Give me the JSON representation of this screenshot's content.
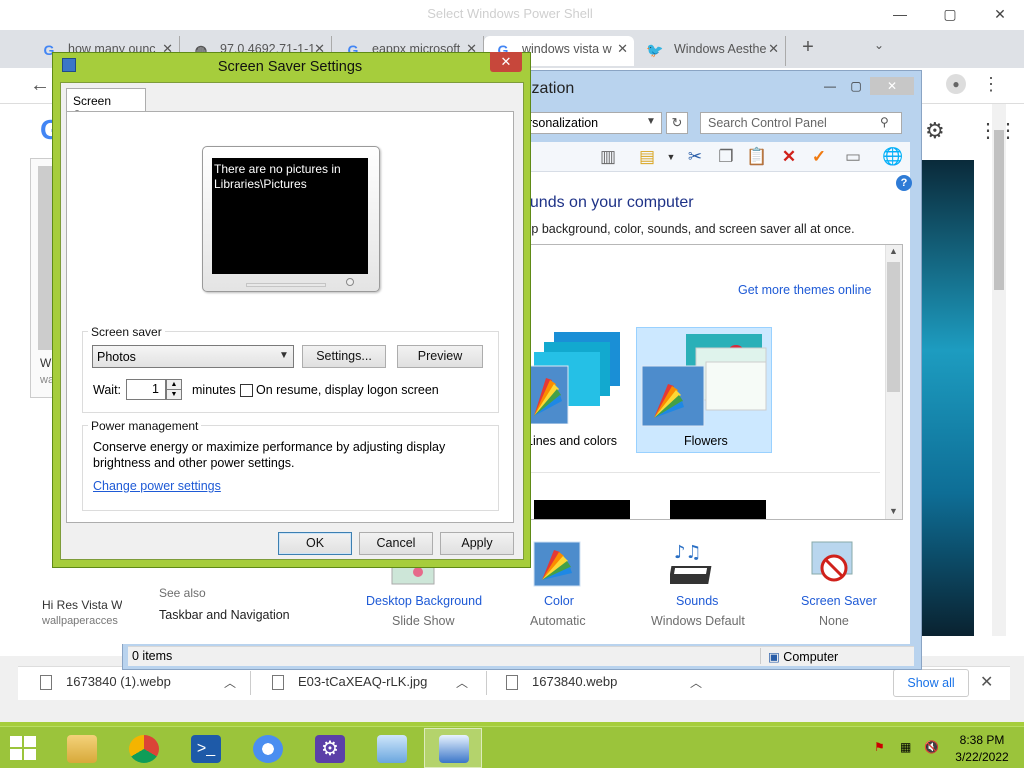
{
  "chrome": {
    "window_title": "Select Windows Power Shell",
    "tabs": [
      {
        "label": "how many ounc",
        "icon": "google-icon"
      },
      {
        "label": "97.0.4692.71-1-1",
        "icon": "globe-icon"
      },
      {
        "label": "eappx microsoft",
        "icon": "google-icon"
      },
      {
        "label": "windows vista w",
        "icon": "google-icon"
      },
      {
        "label": "Windows Aesthe",
        "icon": "twitter-icon"
      }
    ],
    "left_card": {
      "title": "W",
      "subtitle": "wa"
    },
    "result_title": "Hi Res Vista W",
    "result_source": "wallpaperacces",
    "downloads": [
      {
        "name": "1673840 (1).webp"
      },
      {
        "name": "E03-tCaXEAQ-rLK.jpg"
      },
      {
        "name": "1673840.webp"
      }
    ],
    "show_all": "Show all"
  },
  "control_panel": {
    "title": "ization",
    "address": "ersonalization",
    "search_placeholder": "Search Control Panel",
    "heading": "ounds on your computer",
    "description": "top background, color, sounds, and screen saver all at once.",
    "get_more_themes": "Get more themes online",
    "themes": [
      {
        "label": "Lines and colors",
        "selected": false
      },
      {
        "label": "Flowers",
        "selected": true
      }
    ],
    "see_also": "See also",
    "taskbar_nav": "Taskbar and Navigation",
    "bottom_items": [
      {
        "label": "Desktop Background",
        "sub": "Slide Show",
        "icon": "desktop-background-icon"
      },
      {
        "label": "Color",
        "sub": "Automatic",
        "icon": "color-icon"
      },
      {
        "label": "Sounds",
        "sub": "Windows Default",
        "icon": "sounds-icon"
      },
      {
        "label": "Screen Saver",
        "sub": "None",
        "icon": "screen-saver-icon"
      }
    ],
    "status_items": "0 items",
    "status_computer": "Computer"
  },
  "dialog": {
    "title": "Screen Saver Settings",
    "tab": "Screen Saver",
    "preview_text": "There are no pictures in Libraries\\Pictures",
    "screen_saver_group": "Screen saver",
    "screen_saver_value": "Photos",
    "settings_button": "Settings...",
    "preview_button": "Preview",
    "wait_label": "Wait:",
    "wait_value": "1",
    "minutes_label": "minutes",
    "resume_label": "On resume, display logon screen",
    "resume_checked": false,
    "power_group": "Power management",
    "power_desc": "Conserve energy or maximize performance by adjusting display brightness and other power settings.",
    "power_link": "Change power settings",
    "ok": "OK",
    "cancel": "Cancel",
    "apply": "Apply"
  },
  "taskbar": {
    "apps": [
      {
        "name": "file-explorer-icon",
        "active": false
      },
      {
        "name": "chrome-icon",
        "active": false
      },
      {
        "name": "powershell-icon",
        "active": false
      },
      {
        "name": "chromium-icon",
        "active": false
      },
      {
        "name": "settings-gear-icon",
        "active": false
      },
      {
        "name": "control-panel-icon",
        "active": false
      },
      {
        "name": "screen-saver-app-icon",
        "active": true
      }
    ],
    "time": "8:38 PM",
    "date": "3/22/2022"
  },
  "colors": {
    "accent_green": "#a6cd3c",
    "link_blue": "#1e5ad6",
    "close_red": "#c7473b"
  }
}
